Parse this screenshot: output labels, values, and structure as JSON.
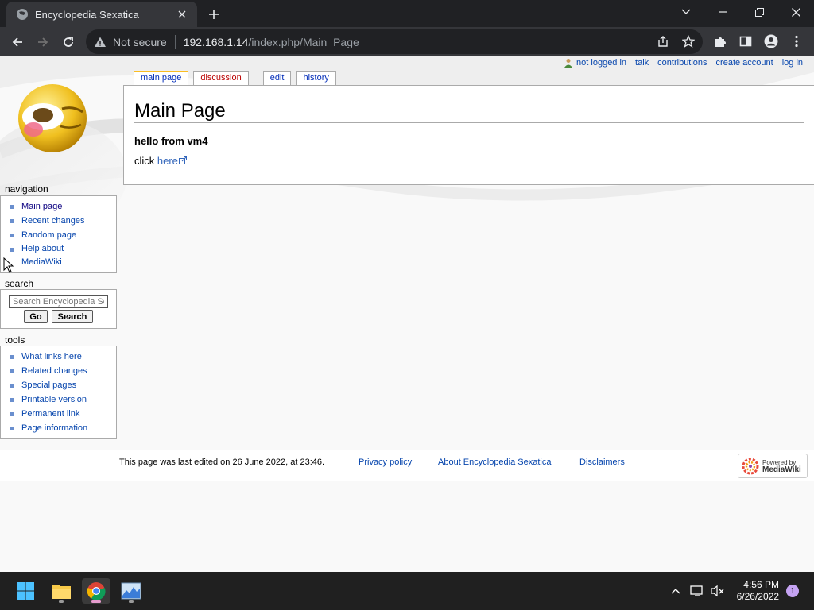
{
  "browser": {
    "tab_title": "Encyclopedia Sexatica",
    "not_secure": "Not secure",
    "url_host": "192.168.1.14",
    "url_path": "/index.php/Main_Page"
  },
  "personal_tools": {
    "not_logged_in": "not logged in",
    "talk": "talk",
    "contributions": "contributions",
    "create_account": "create account",
    "log_in": "log in"
  },
  "content_tabs": [
    {
      "label": "main page"
    },
    {
      "label": "discussion"
    },
    {
      "label": "edit"
    },
    {
      "label": "history"
    }
  ],
  "article": {
    "title": "Main Page",
    "para1": "hello from vm4",
    "click_prefix": "click ",
    "link_text": "here"
  },
  "sidebar": {
    "navigation_title": "navigation",
    "navigation": [
      "Main page",
      "Recent changes",
      "Random page",
      "Help about MediaWiki"
    ],
    "search_title": "search",
    "search_placeholder": "Search Encyclopedia Sexatica",
    "go_label": "Go",
    "search_label": "Search",
    "tools_title": "tools",
    "tools": [
      "What links here",
      "Related changes",
      "Special pages",
      "Printable version",
      "Permanent link",
      "Page information"
    ]
  },
  "footer": {
    "last_edited": "This page was last edited on 26 June 2022, at 23:46.",
    "privacy": "Privacy policy",
    "about": "About Encyclopedia Sexatica",
    "disclaimers": "Disclaimers",
    "powered_by": "Powered by",
    "mediawiki": "MediaWiki"
  },
  "taskbar": {
    "time": "4:56 PM",
    "date": "6/26/2022",
    "notification_count": "1"
  },
  "icons": {
    "favicon": "globe-icon",
    "close": "close-icon",
    "new_tab": "plus-icon",
    "back": "arrow-left-icon",
    "forward": "arrow-right-icon",
    "reload": "reload-icon",
    "warning": "warning-icon",
    "share": "share-icon",
    "bookmark": "star-icon",
    "extensions": "puzzle-icon",
    "side_panel": "side-panel-icon",
    "profile": "profile-icon",
    "menu": "kebab-menu-icon"
  },
  "colors": {
    "link": "#0645ad",
    "visited": "#0b0080",
    "new_link": "#ba0000",
    "tab_border_selected": "#fabd23",
    "accent_notification": "#c5a3f2"
  }
}
